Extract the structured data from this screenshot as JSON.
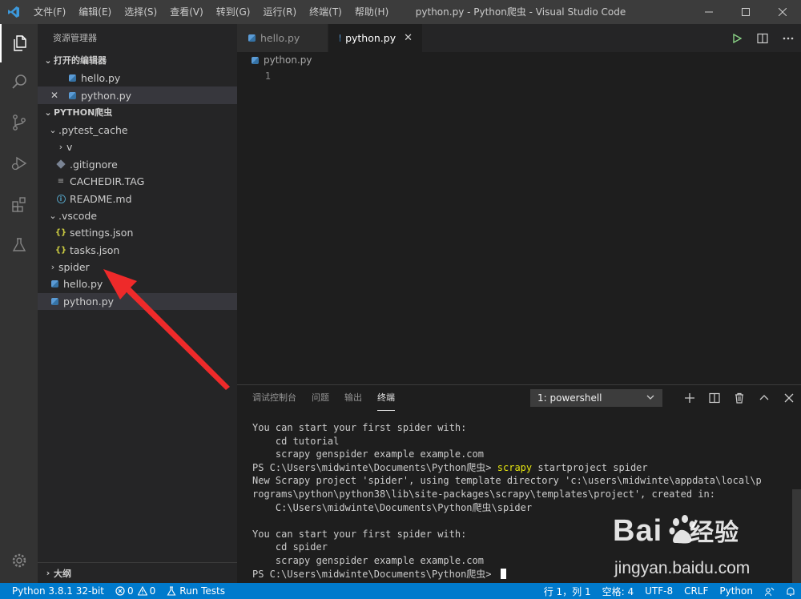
{
  "titlebar": {
    "menu": [
      "文件(F)",
      "编辑(E)",
      "选择(S)",
      "查看(V)",
      "转到(G)",
      "运行(R)",
      "终端(T)",
      "帮助(H)"
    ],
    "title": "python.py - Python爬虫 - Visual Studio Code"
  },
  "sidebar": {
    "title": "资源管理器",
    "open_editors_header": "打开的编辑器",
    "open_editors": [
      "hello.py",
      "python.py"
    ],
    "project_header": "PYTHON爬虫",
    "tree": [
      ".pytest_cache",
      "v",
      ".gitignore",
      "CACHEDIR.TAG",
      "README.md",
      ".vscode",
      "settings.json",
      "tasks.json",
      "spider",
      "hello.py",
      "python.py"
    ],
    "outline": "大纲"
  },
  "editor": {
    "tabs": [
      "hello.py",
      "python.py"
    ],
    "breadcrumb": "python.py",
    "line_number": "1"
  },
  "panel": {
    "tabs": [
      "调试控制台",
      "问题",
      "输出",
      "终端"
    ],
    "terminal_select": "1: powershell",
    "lines": [
      "You can start your first spider with:",
      "    cd tutorial",
      "    scrapy genspider example example.com",
      "PS C:\\Users\\midwinte\\Documents\\Python爬虫> ",
      "New Scrapy project 'spider', using template directory 'c:\\users\\midwinte\\appdata\\local\\p",
      "rograms\\python\\python38\\lib\\site-packages\\scrapy\\templates\\project', created in:",
      "    C:\\Users\\midwinte\\Documents\\Python爬虫\\spider",
      "",
      "You can start your first spider with:",
      "    cd spider",
      "    scrapy genspider example example.com",
      "PS C:\\Users\\midwinte\\Documents\\Python爬虫> "
    ],
    "cmd_keyword": "scrapy",
    "cmd_rest": " startproject spider"
  },
  "statusbar": {
    "interpreter": "Python 3.8.1 32-bit",
    "errors": "0",
    "warnings": "0",
    "run_tests": "Run Tests",
    "position": "行 1，列 1",
    "spaces": "空格: 4",
    "encoding": "UTF-8",
    "eol": "CRLF",
    "language": "Python"
  },
  "watermark": {
    "brand_latin": "Bai",
    "brand_cn": "经验",
    "url": "jingyan.baidu.com"
  },
  "colors": {
    "accent": "#007acc",
    "annotation_arrow": "#ee2a2a"
  }
}
